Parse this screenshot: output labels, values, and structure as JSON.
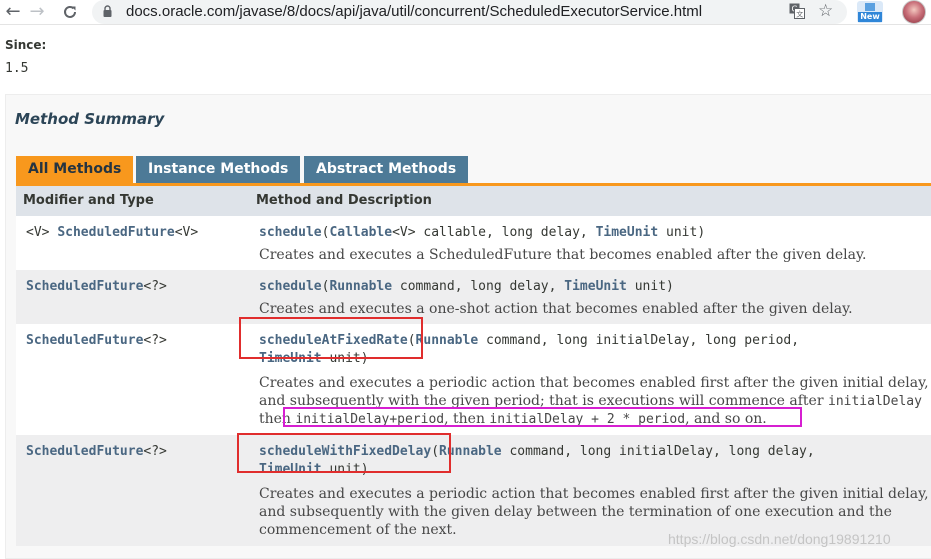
{
  "browser": {
    "url": "docs.oracle.com/javase/8/docs/api/java/util/concurrent/ScheduledExecutorService.html",
    "new_badge": "New",
    "icons": [
      "back-arrow-icon",
      "forward-arrow-icon",
      "reload-icon",
      "lock-icon",
      "translate-icon",
      "star-icon",
      "new-badge-icon",
      "profile-avatar"
    ]
  },
  "page": {
    "since_heading": "Since:",
    "since_value": "1.5",
    "summary_title": "Method Summary",
    "tabs": [
      "All Methods",
      "Instance Methods",
      "Abstract Methods"
    ],
    "headers": [
      "Modifier and Type",
      "Method and Description"
    ],
    "rows": [
      {
        "mod_prefix": "<V> ",
        "mod_type": "ScheduledFuture",
        "mod_suffix": "<V>",
        "method": "schedule",
        "p1_open": "(",
        "p1_type": "Callable",
        "p1_rest": "<V> callable, long delay, ",
        "p2_type": "TimeUnit",
        "p2_rest": " unit)",
        "desc": "Creates and executes a ScheduledFuture that becomes enabled after the given delay."
      },
      {
        "mod_type": "ScheduledFuture",
        "mod_suffix": "<?>",
        "method": "schedule",
        "p1_open": "(",
        "p1_type": "Runnable",
        "p1_rest": " command, long delay, ",
        "p2_type": "TimeUnit",
        "p2_rest": " unit)",
        "desc": "Creates and executes a one-shot action that becomes enabled after the given delay."
      },
      {
        "mod_type": "ScheduledFuture",
        "mod_suffix": "<?>",
        "method": "scheduleAtFixedRate",
        "p1_open": "(",
        "p1_type": "Runnable",
        "p1_rest": " command, long initialDelay, long period,",
        "p2_type": "TimeUnit",
        "p2_rest": " unit)",
        "desc1": "Creates and executes a periodic action that becomes enabled first after the given initial delay,",
        "desc2a": "and subsequently with the given period; that is executions will commence after ",
        "desc2b": "initialDelay",
        "desc3a": "then ",
        "desc3b": "initialDelay+period",
        "desc3c": ", then ",
        "desc3d": "initialDelay + 2 * period",
        "desc3e": ", and so on."
      },
      {
        "mod_type": "ScheduledFuture",
        "mod_suffix": "<?>",
        "method": "scheduleWithFixedDelay",
        "p1_open": "(",
        "p1_type": "Runnable",
        "p1_rest": " command, long initialDelay, long delay,",
        "p2_type": "TimeUnit",
        "p2_rest": " unit)",
        "desc1": "Creates and executes a periodic action that becomes enabled first after the given initial delay,",
        "desc2": "and subsequently with the given delay between the termination of one execution and the",
        "desc3": "commencement of the next."
      }
    ]
  },
  "watermark": "https://blog.csdn.net/dong19891210",
  "colors": {
    "tab_active": "#f8981d",
    "tab_inactive": "#4d7a97",
    "link": "#4a6782",
    "header_bg": "#dee3e9",
    "highlight_red": "#e02d2d",
    "highlight_magenta": "#d61fd1"
  }
}
